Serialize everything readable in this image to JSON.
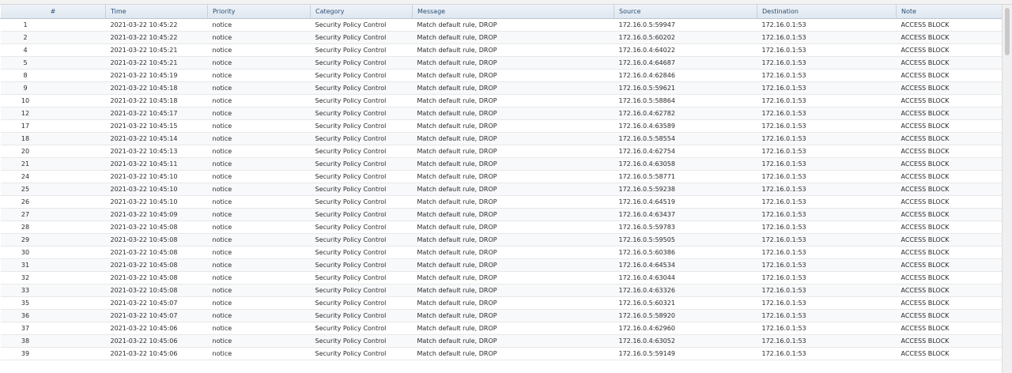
{
  "columns": [
    "#",
    "Time",
    "Priority",
    "Category",
    "Message",
    "Source",
    "Destination",
    "Note"
  ],
  "rows": [
    [
      "1",
      "2021-03-22 10:45:22",
      "notice",
      "Security Policy Control",
      "Match default rule, DROP",
      "172.16.0.5:59947",
      "172.16.0.1:53",
      "ACCESS BLOCK"
    ],
    [
      "2",
      "2021-03-22 10:45:22",
      "notice",
      "Security Policy Control",
      "Match default rule, DROP",
      "172.16.0.5:60202",
      "172.16.0.1:53",
      "ACCESS BLOCK"
    ],
    [
      "4",
      "2021-03-22 10:45:21",
      "notice",
      "Security Policy Control",
      "Match default rule, DROP",
      "172.16.0.4:64022",
      "172.16.0.1:53",
      "ACCESS BLOCK"
    ],
    [
      "5",
      "2021-03-22 10:45:21",
      "notice",
      "Security Policy Control",
      "Match default rule, DROP",
      "172.16.0.4:64687",
      "172.16.0.1:53",
      "ACCESS BLOCK"
    ],
    [
      "8",
      "2021-03-22 10:45:19",
      "notice",
      "Security Policy Control",
      "Match default rule, DROP",
      "172.16.0.4:62846",
      "172.16.0.1:53",
      "ACCESS BLOCK"
    ],
    [
      "9",
      "2021-03-22 10:45:18",
      "notice",
      "Security Policy Control",
      "Match default rule, DROP",
      "172.16.0.5:59621",
      "172.16.0.1:53",
      "ACCESS BLOCK"
    ],
    [
      "10",
      "2021-03-22 10:45:18",
      "notice",
      "Security Policy Control",
      "Match default rule, DROP",
      "172.16.0.5:58864",
      "172.16.0.1:53",
      "ACCESS BLOCK"
    ],
    [
      "12",
      "2021-03-22 10:45:17",
      "notice",
      "Security Policy Control",
      "Match default rule, DROP",
      "172.16.0.4:62782",
      "172.16.0.1:53",
      "ACCESS BLOCK"
    ],
    [
      "17",
      "2021-03-22 10:45:15",
      "notice",
      "Security Policy Control",
      "Match default rule, DROP",
      "172.16.0.4:63589",
      "172.16.0.1:53",
      "ACCESS BLOCK"
    ],
    [
      "18",
      "2021-03-22 10:45:14",
      "notice",
      "Security Policy Control",
      "Match default rule, DROP",
      "172.16.0.5:58554",
      "172.16.0.1:53",
      "ACCESS BLOCK"
    ],
    [
      "20",
      "2021-03-22 10:45:13",
      "notice",
      "Security Policy Control",
      "Match default rule, DROP",
      "172.16.0.4:62754",
      "172.16.0.1:53",
      "ACCESS BLOCK"
    ],
    [
      "21",
      "2021-03-22 10:45:11",
      "notice",
      "Security Policy Control",
      "Match default rule, DROP",
      "172.16.0.4:63058",
      "172.16.0.1:53",
      "ACCESS BLOCK"
    ],
    [
      "24",
      "2021-03-22 10:45:10",
      "notice",
      "Security Policy Control",
      "Match default rule, DROP",
      "172.16.0.5:58771",
      "172.16.0.1:53",
      "ACCESS BLOCK"
    ],
    [
      "25",
      "2021-03-22 10:45:10",
      "notice",
      "Security Policy Control",
      "Match default rule, DROP",
      "172.16.0.5:59238",
      "172.16.0.1:53",
      "ACCESS BLOCK"
    ],
    [
      "26",
      "2021-03-22 10:45:10",
      "notice",
      "Security Policy Control",
      "Match default rule, DROP",
      "172.16.0.4:64519",
      "172.16.0.1:53",
      "ACCESS BLOCK"
    ],
    [
      "27",
      "2021-03-22 10:45:09",
      "notice",
      "Security Policy Control",
      "Match default rule, DROP",
      "172.16.0.4:63437",
      "172.16.0.1:53",
      "ACCESS BLOCK"
    ],
    [
      "28",
      "2021-03-22 10:45:08",
      "notice",
      "Security Policy Control",
      "Match default rule, DROP",
      "172.16.0.5:59783",
      "172.16.0.1:53",
      "ACCESS BLOCK"
    ],
    [
      "29",
      "2021-03-22 10:45:08",
      "notice",
      "Security Policy Control",
      "Match default rule, DROP",
      "172.16.0.5:59505",
      "172.16.0.1:53",
      "ACCESS BLOCK"
    ],
    [
      "30",
      "2021-03-22 10:45:08",
      "notice",
      "Security Policy Control",
      "Match default rule, DROP",
      "172.16.0.5:60386",
      "172.16.0.1:53",
      "ACCESS BLOCK"
    ],
    [
      "31",
      "2021-03-22 10:45:08",
      "notice",
      "Security Policy Control",
      "Match default rule, DROP",
      "172.16.0.4:64534",
      "172.16.0.1:53",
      "ACCESS BLOCK"
    ],
    [
      "32",
      "2021-03-22 10:45:08",
      "notice",
      "Security Policy Control",
      "Match default rule, DROP",
      "172.16.0.4:63044",
      "172.16.0.1:53",
      "ACCESS BLOCK"
    ],
    [
      "33",
      "2021-03-22 10:45:08",
      "notice",
      "Security Policy Control",
      "Match default rule, DROP",
      "172.16.0.4:63326",
      "172.16.0.1:53",
      "ACCESS BLOCK"
    ],
    [
      "35",
      "2021-03-22 10:45:07",
      "notice",
      "Security Policy Control",
      "Match default rule, DROP",
      "172.16.0.5:60321",
      "172.16.0.1:53",
      "ACCESS BLOCK"
    ],
    [
      "36",
      "2021-03-22 10:45:07",
      "notice",
      "Security Policy Control",
      "Match default rule, DROP",
      "172.16.0.5:58920",
      "172.16.0.1:53",
      "ACCESS BLOCK"
    ],
    [
      "37",
      "2021-03-22 10:45:06",
      "notice",
      "Security Policy Control",
      "Match default rule, DROP",
      "172.16.0.4:62960",
      "172.16.0.1:53",
      "ACCESS BLOCK"
    ],
    [
      "38",
      "2021-03-22 10:45:06",
      "notice",
      "Security Policy Control",
      "Match default rule, DROP",
      "172.16.0.4:63052",
      "172.16.0.1:53",
      "ACCESS BLOCK"
    ],
    [
      "39",
      "2021-03-22 10:45:06",
      "notice",
      "Security Policy Control",
      "Match default rule, DROP",
      "172.16.0.5:59149",
      "172.16.0.1:53",
      "ACCESS BLOCK"
    ]
  ],
  "colors": {
    "header_text": "#2a4f78",
    "header_bg": "#e6edf4",
    "row_stripe": "#f7f9fb"
  }
}
